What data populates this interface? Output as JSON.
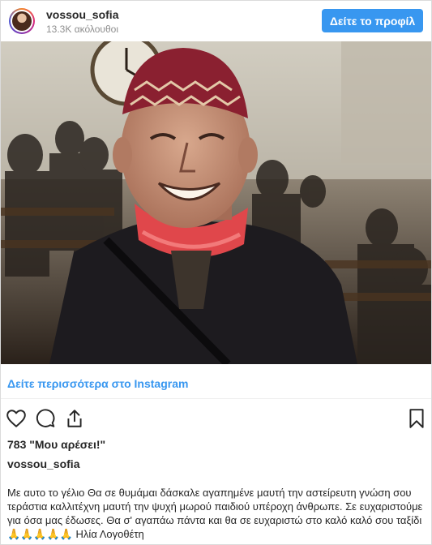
{
  "header": {
    "username": "vossou_sofia",
    "followers": "13.3K ακόλουθοι",
    "profile_button": "Δείτε το προφίλ"
  },
  "post": {
    "see_more_link": "Δείτε περισσότερα στο Instagram",
    "likes": "783 \"Μου αρέσει!\"",
    "caption_username": "vossou_sofia",
    "caption_text": "Με αυτο το γέλιο Θα σε θυμάμαι δάσκαλε αγαπημένε μαυτή την αστείρευτη γνώση σου τεράστια καλλιτέχνη μαυτή την ψυχή μωρού παιδιού υπέροχη άνθρωπε. Σε ευχαριστούμε για όσα μας έδωσες. Θα σ' αγαπάω πάντα και θα σε ευχαριστώ στο καλό καλό σου ταξίδι 🙏🙏🙏🙏🙏 Ηλία Λογοθέτη"
  },
  "icons": {
    "like": "heart-icon",
    "comment": "comment-icon",
    "share": "share-icon",
    "save": "bookmark-icon"
  },
  "colors": {
    "accent": "#3897f0",
    "text": "#262626",
    "muted": "#8e8e8e"
  }
}
